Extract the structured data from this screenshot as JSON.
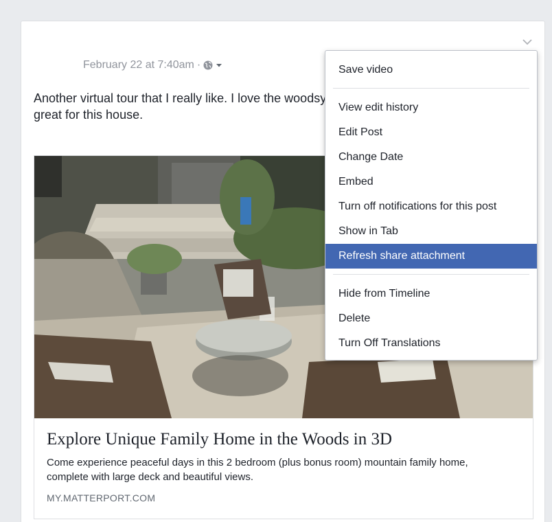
{
  "post": {
    "timestamp": "February 22 at 7:40am",
    "separator": "·",
    "audience_icon": "globe-icon",
    "text": "Another virtual tour that I really like. I love the woodsy setting. Especially the patio, it's great for this house.",
    "options_icon": "chevron-down-icon"
  },
  "attachment": {
    "title": "Explore Unique Family Home in the Woods in 3D",
    "description": "Come experience peaceful days in this 2 bedroom (plus bonus room) mountain family home, complete with large deck and beautiful views.",
    "domain": "MY.MATTERPORT.COM"
  },
  "menu": {
    "group1": [
      "Save video"
    ],
    "group2": [
      "View edit history",
      "Edit Post",
      "Change Date",
      "Embed",
      "Turn off notifications for this post",
      "Show in Tab",
      "Refresh share attachment"
    ],
    "group3": [
      "Hide from Timeline",
      "Delete",
      "Turn Off Translations"
    ],
    "active_item": "Refresh share attachment"
  },
  "colors": {
    "accent": "#4267b2",
    "background": "#e9ebee",
    "meta_text": "#90949c"
  }
}
